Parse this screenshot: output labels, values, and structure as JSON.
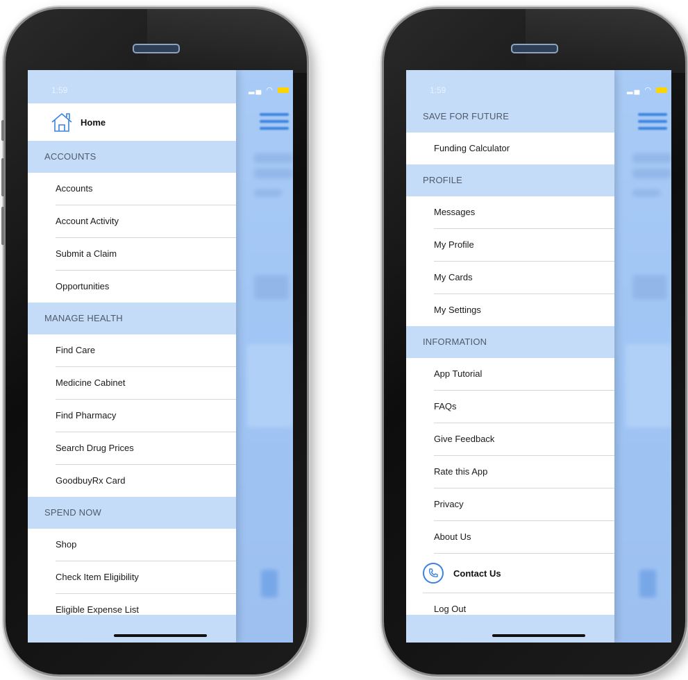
{
  "left_phone": {
    "status_time": "1:59",
    "home_label": "Home",
    "groups": [
      {
        "title": "ACCOUNTS",
        "items": [
          "Accounts",
          "Account Activity",
          "Submit a Claim",
          "Opportunities"
        ]
      },
      {
        "title": "MANAGE HEALTH",
        "items": [
          "Find Care",
          "Medicine Cabinet",
          "Find Pharmacy",
          "Search Drug Prices",
          "GoodbuyRx Card"
        ]
      },
      {
        "title": "SPEND NOW",
        "items": [
          "Shop",
          "Check Item Eligibility",
          "Eligible Expense List"
        ]
      }
    ]
  },
  "right_phone": {
    "status_time": "1:59",
    "groups": [
      {
        "title": "SAVE FOR FUTURE",
        "items": [
          "Funding Calculator"
        ]
      },
      {
        "title": "PROFILE",
        "items": [
          "Messages",
          "My Profile",
          "My Cards",
          "My Settings"
        ]
      },
      {
        "title": "INFORMATION",
        "items": [
          "App Tutorial",
          "FAQs",
          "Give Feedback",
          "Rate this App",
          "Privacy",
          "About Us"
        ]
      }
    ],
    "contact_label": "Contact Us",
    "logout_label": "Log Out"
  },
  "colors": {
    "accent": "#3b82e0",
    "section_bg": "#c5dcf8",
    "screen_bg": "#a6c8f5"
  },
  "icons": {
    "home": "home-icon",
    "contact": "phone-icon",
    "menu": "hamburger-icon"
  }
}
